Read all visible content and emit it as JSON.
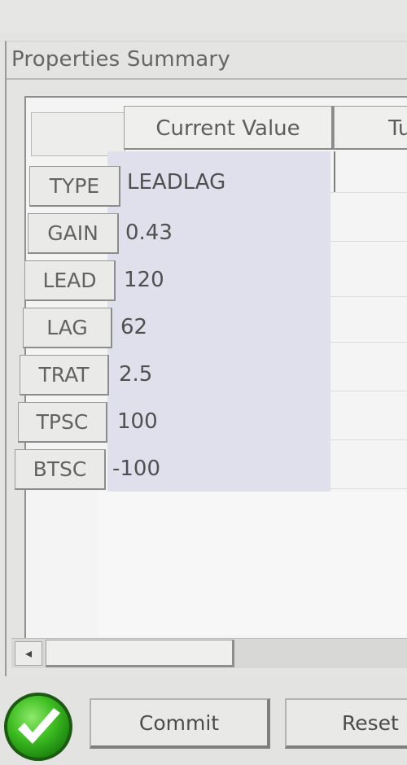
{
  "panel": {
    "title": "Properties Summary"
  },
  "table": {
    "columns": [
      "Current Value",
      "Tu"
    ],
    "rows": [
      {
        "name": "TYPE",
        "value": "LEADLAG"
      },
      {
        "name": "GAIN",
        "value": "0.43"
      },
      {
        "name": "LEAD",
        "value": "120"
      },
      {
        "name": "LAG",
        "value": "62"
      },
      {
        "name": "TRAT",
        "value": "2.5"
      },
      {
        "name": "TPSC",
        "value": "100"
      },
      {
        "name": "BTSC",
        "value": "-100"
      }
    ]
  },
  "scrollbar": {
    "left_arrow": "◂"
  },
  "buttons": {
    "ok_icon": "check-circle-icon",
    "commit": "Commit",
    "reset": "Reset"
  },
  "colors": {
    "value_column": "#dfe0ec",
    "ok_green": "#39b81f"
  }
}
